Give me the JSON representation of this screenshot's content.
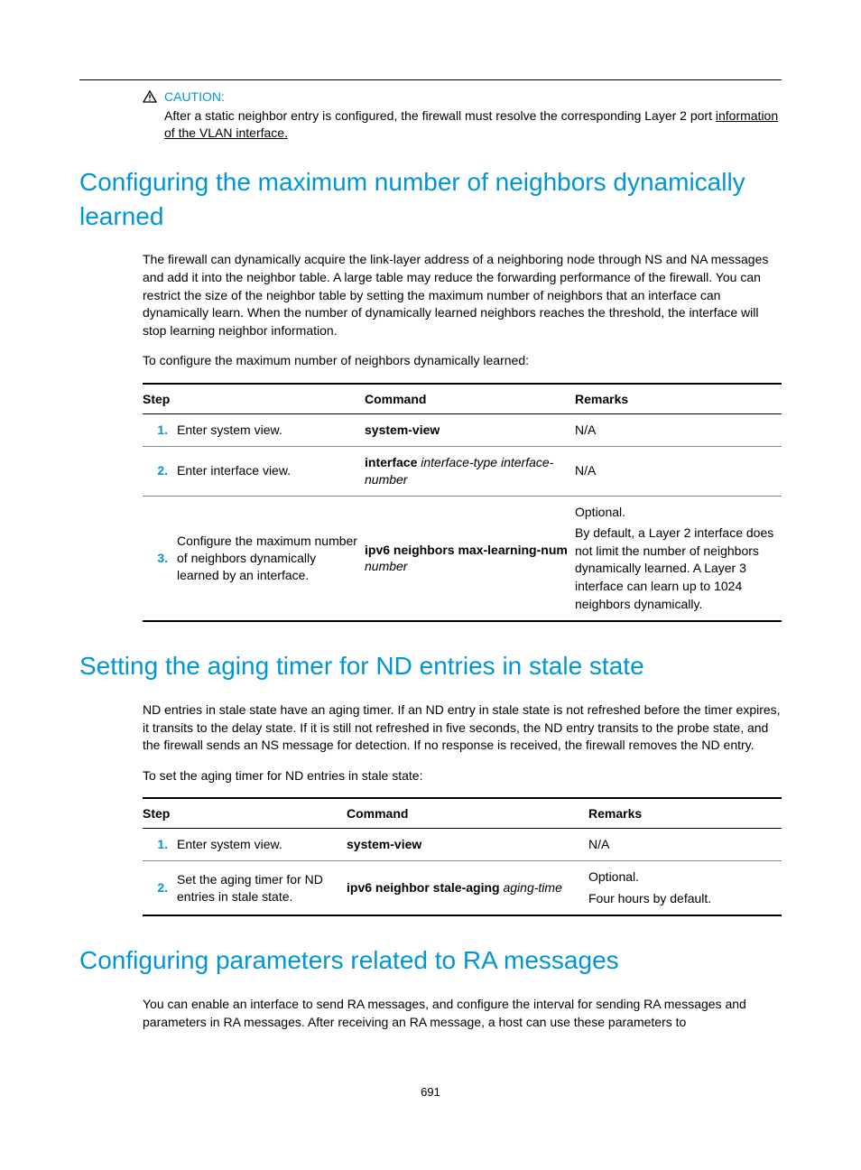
{
  "caution": {
    "label": "CAUTION:",
    "text_part1": "After a static neighbor entry is configured, the firewall must resolve the corresponding Layer 2 port ",
    "text_underlined": "information of the VLAN interface."
  },
  "section1": {
    "heading": "Configuring the maximum number of neighbors dynamically learned",
    "para1": "The firewall can dynamically acquire the link-layer address of a neighboring node through NS and NA messages and add it into the neighbor table. A large table may reduce the forwarding performance of the firewall. You can restrict the size of the neighbor table by setting the maximum number of neighbors that an interface can dynamically learn. When the number of dynamically learned neighbors reaches the threshold, the interface will stop learning neighbor information.",
    "para2": "To configure the maximum number of neighbors dynamically learned:",
    "table": {
      "headers": {
        "step": "Step",
        "command": "Command",
        "remarks": "Remarks"
      },
      "rows": [
        {
          "num": "1.",
          "step": "Enter system view.",
          "cmd_bold": "system-view",
          "cmd_ital": "",
          "remarks_plain": "N/A"
        },
        {
          "num": "2.",
          "step": "Enter interface view.",
          "cmd_bold": "interface",
          "cmd_ital": " interface-type interface-number",
          "remarks_plain": "N/A"
        },
        {
          "num": "3.",
          "step": "Configure the maximum number of neighbors dynamically learned by an interface.",
          "cmd_bold": "ipv6 neighbors max-learning-num",
          "cmd_ital": " number",
          "remarks_line1": "Optional.",
          "remarks_line2": "By default, a Layer 2 interface does not limit the number of neighbors dynamically learned. A Layer 3 interface can learn up to 1024 neighbors dynamically."
        }
      ]
    }
  },
  "section2": {
    "heading": "Setting the aging timer for ND entries in stale state",
    "para1": "ND entries in stale state have an aging timer. If an ND entry in stale state is not refreshed before the timer expires, it transits to the delay state. If it is still not refreshed in five seconds, the ND entry transits to the probe state, and the firewall sends an NS message for detection. If no response is received, the firewall removes the ND entry.",
    "para2": "To set the aging timer for ND entries in stale state:",
    "table": {
      "headers": {
        "step": "Step",
        "command": "Command",
        "remarks": "Remarks"
      },
      "rows": [
        {
          "num": "1.",
          "step": "Enter system view.",
          "cmd_bold": "system-view",
          "cmd_ital": "",
          "remarks_plain": "N/A"
        },
        {
          "num": "2.",
          "step": "Set the aging timer for ND entries in stale state.",
          "cmd_bold": "ipv6 neighbor stale-aging",
          "cmd_ital": " aging-time",
          "remarks_line1": "Optional.",
          "remarks_line2": "Four hours by default."
        }
      ]
    }
  },
  "section3": {
    "heading": "Configuring parameters related to RA messages",
    "para1": "You can enable an interface to send RA messages, and configure the interval for sending RA messages and parameters in RA messages. After receiving an RA message, a host can use these parameters to"
  },
  "page_number": "691"
}
